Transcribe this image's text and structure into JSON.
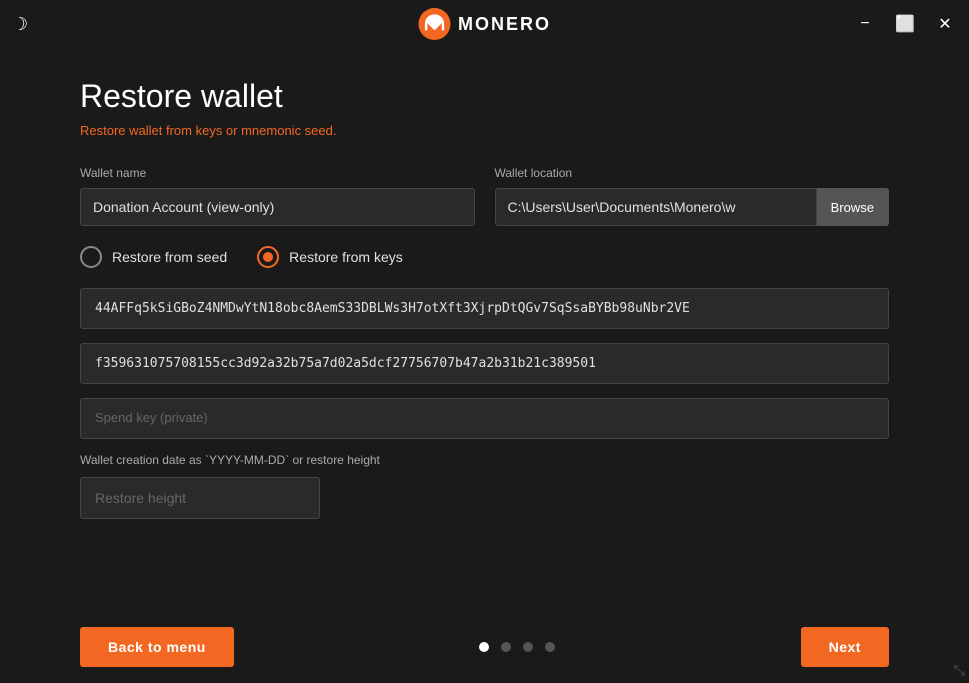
{
  "titlebar": {
    "title": "MONERO",
    "minimize_label": "−",
    "maximize_label": "⬜",
    "close_label": "✕"
  },
  "page": {
    "title": "Restore wallet",
    "subtitle": "Restore wallet from keys or mnemonic seed."
  },
  "form": {
    "wallet_name_label": "Wallet name",
    "wallet_name_value": "Donation Account (view-only)",
    "wallet_location_label": "Wallet location",
    "wallet_location_value": "C:\\Users\\User\\Documents\\Monero\\w",
    "browse_label": "Browse",
    "restore_from_seed_label": "Restore from seed",
    "restore_from_keys_label": "Restore from keys",
    "address_value": "44AFFq5kSiGBoZ4NMDwYtN18obc8AemS33DBLWs3H7otXft3XjrpDtQGv7SqSsaBYBb98uNbr2VE",
    "view_key_value": "f359631075708155cc3d92a32b75a7d02a5dcf27756707b47a2b31b21c389501",
    "spend_key_placeholder": "Spend key (private)",
    "creation_date_label": "Wallet creation date as `YYYY-MM-DD` or restore height",
    "restore_height_placeholder": "Restore height"
  },
  "pagination": {
    "dots": [
      {
        "active": true
      },
      {
        "active": false
      },
      {
        "active": false
      },
      {
        "active": false
      }
    ]
  },
  "nav": {
    "back_label": "Back to menu",
    "next_label": "Next"
  }
}
